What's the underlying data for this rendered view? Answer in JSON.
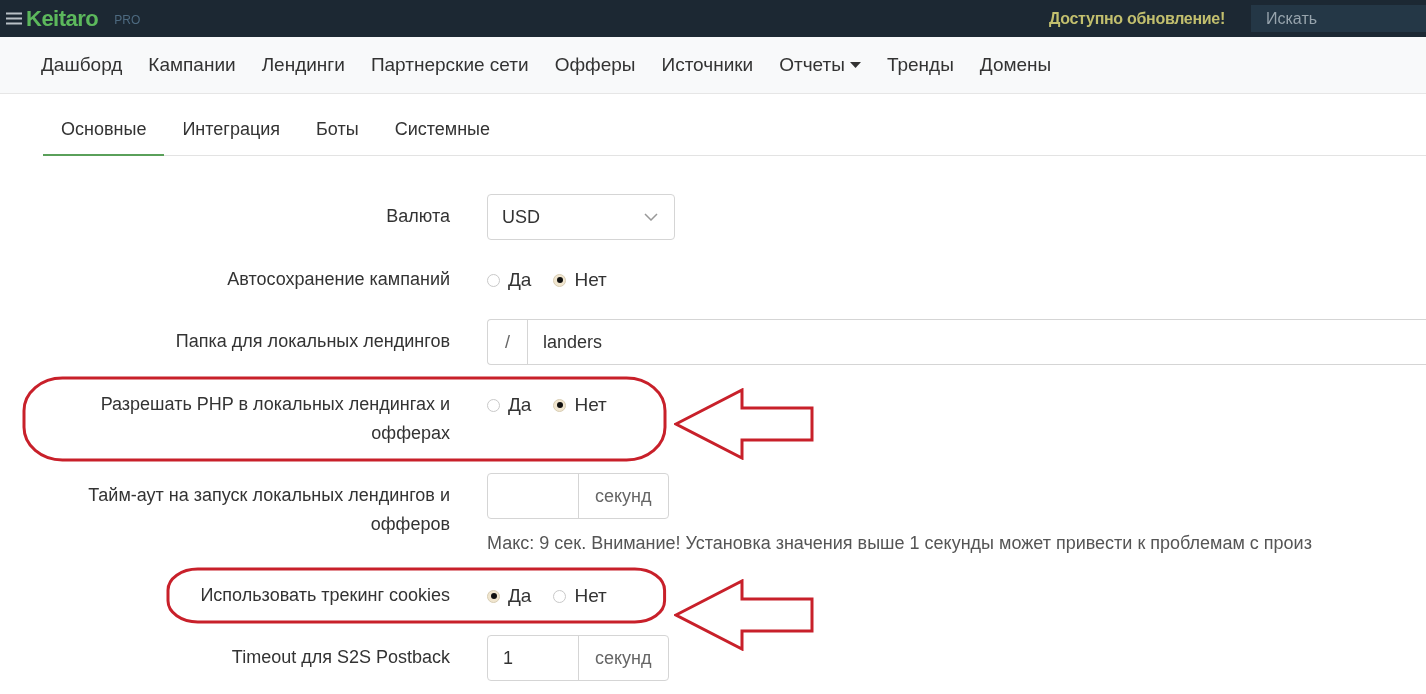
{
  "topbar": {
    "logo": "Keitaro",
    "edition": "PRO",
    "update_notice": "Доступно обновление!",
    "search": {
      "placeholder": "Искать"
    }
  },
  "nav": [
    {
      "label": "Дашборд",
      "dropdown": false
    },
    {
      "label": "Кампании",
      "dropdown": false
    },
    {
      "label": "Лендинги",
      "dropdown": false
    },
    {
      "label": "Партнерские сети",
      "dropdown": false
    },
    {
      "label": "Офферы",
      "dropdown": false
    },
    {
      "label": "Источники",
      "dropdown": false
    },
    {
      "label": "Отчеты",
      "dropdown": true
    },
    {
      "label": "Тренды",
      "dropdown": false
    },
    {
      "label": "Домены",
      "dropdown": false
    }
  ],
  "tabs": [
    {
      "label": "Основные",
      "selected": true
    },
    {
      "label": "Интеграция",
      "selected": false
    },
    {
      "label": "Боты",
      "selected": false
    },
    {
      "label": "Системные",
      "selected": false
    }
  ],
  "form": [
    {
      "kind": "select",
      "label": "Валюта",
      "value": "USD",
      "highlighted": false
    },
    {
      "kind": "radio",
      "label": "Автосохранение кампаний",
      "options": [
        {
          "label": "Да",
          "selected": false
        },
        {
          "label": "Нет",
          "selected": true
        }
      ],
      "highlighted": false
    },
    {
      "kind": "prefixed",
      "label": "Папка для локальных лендингов",
      "prefix": "/",
      "value": "landers",
      "highlighted": false
    },
    {
      "kind": "radio",
      "label": "Разрешать PHP в локальных лендингах и офферах",
      "options": [
        {
          "label": "Да",
          "selected": false
        },
        {
          "label": "Нет",
          "selected": true
        }
      ],
      "highlighted": true
    },
    {
      "kind": "number",
      "label": "Тайм-аут на запуск локальных лендингов и офферов",
      "suffix": "секунд",
      "help": "Макс: 9 сек. Внимание! Установка значения выше 1 секунды может привести к проблемам с произ",
      "highlighted": false
    },
    {
      "kind": "radio",
      "label": "Использовать трекинг cookies",
      "options": [
        {
          "label": "Да",
          "selected": true
        },
        {
          "label": "Нет",
          "selected": false
        }
      ],
      "highlighted": true
    },
    {
      "kind": "number",
      "label": "Timeout для S2S Postback",
      "value": "1",
      "suffix": "секунд",
      "highlighted": false
    }
  ]
}
